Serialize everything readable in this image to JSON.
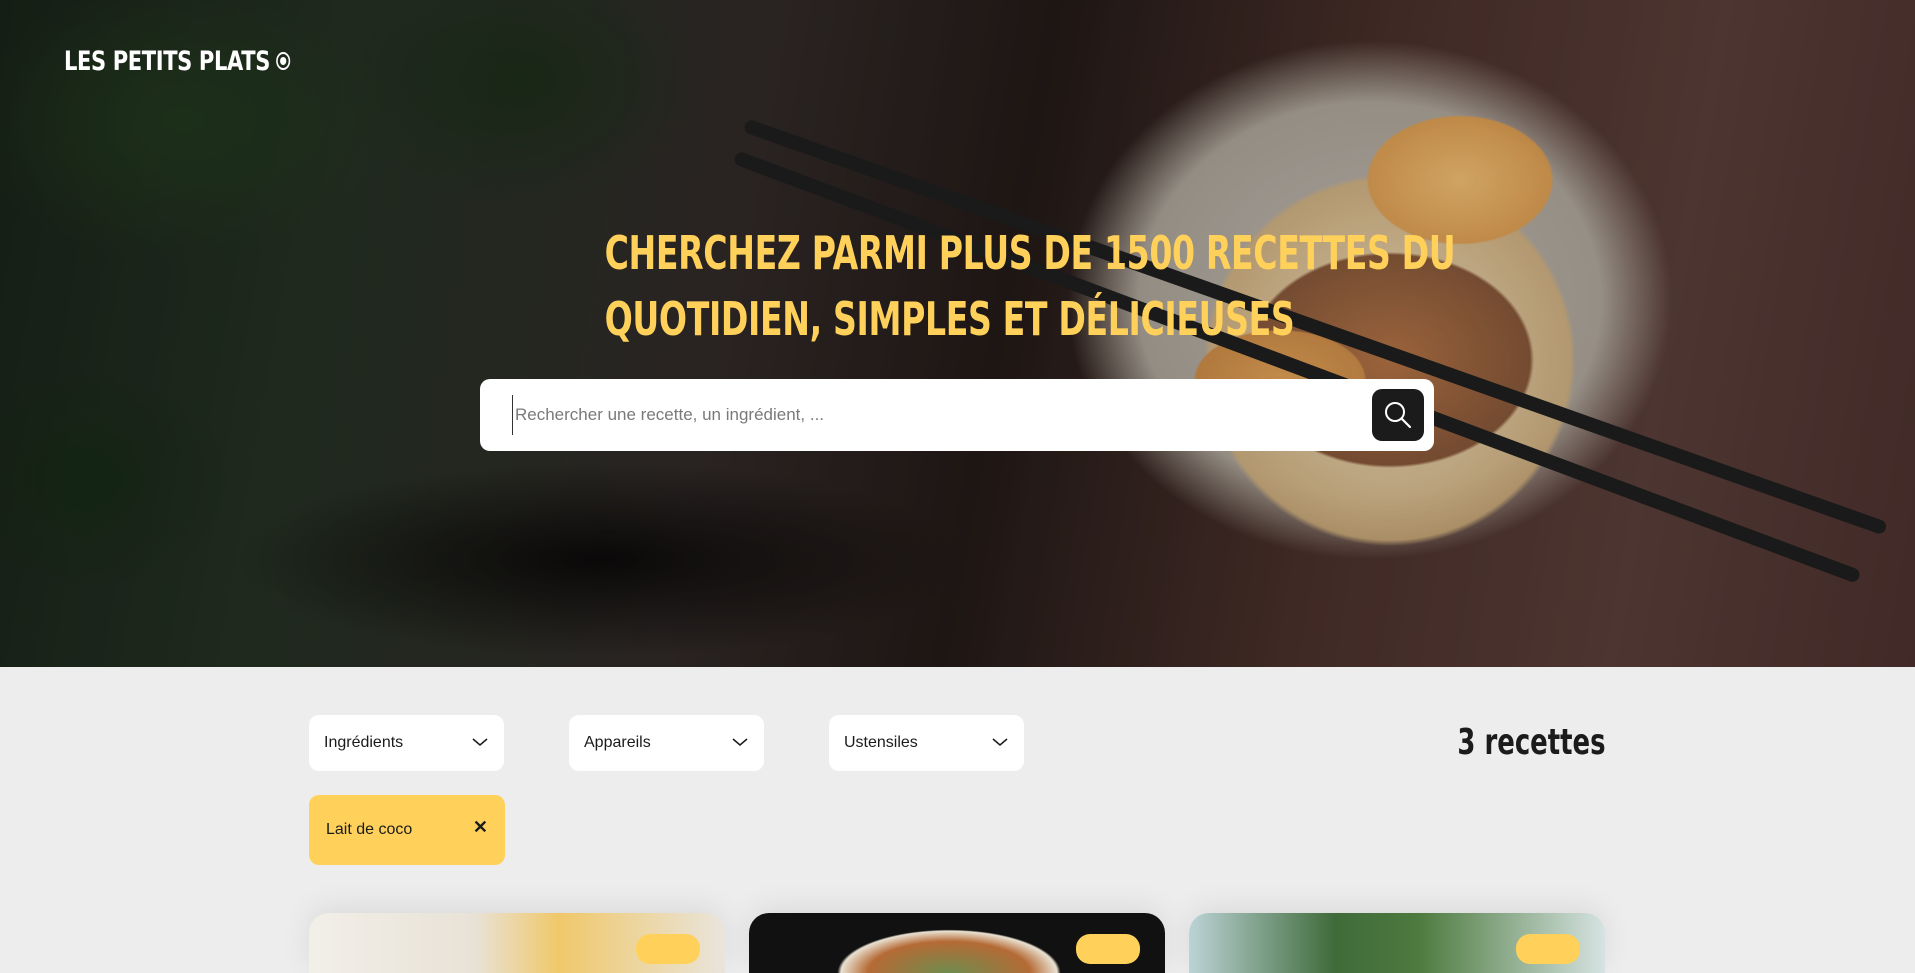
{
  "brand": {
    "logo_text": "LES PETITS PLATS"
  },
  "hero": {
    "title_line1": "CHERCHEZ PARMI PLUS DE 1500 RECETTES DU",
    "title_line2": "QUOTIDIEN, SIMPLES ET DÉLICIEUSES"
  },
  "search": {
    "value": "",
    "placeholder": "Rechercher une recette, un ingrédient, ...",
    "button_icon": "search-icon"
  },
  "filters": {
    "dropdowns": [
      {
        "label": "Ingrédients",
        "icon": "chevron-down-icon"
      },
      {
        "label": "Appareils",
        "icon": "chevron-down-icon"
      },
      {
        "label": "Ustensiles",
        "icon": "chevron-down-icon"
      }
    ],
    "active_tags": [
      {
        "label": "Lait de coco",
        "close_icon": "close-icon",
        "close_glyph": "✕"
      }
    ]
  },
  "results": {
    "count_label": "3 recettes"
  },
  "colors": {
    "accent": "#ffd15b",
    "dark": "#1b1b1b",
    "background": "#ededed"
  }
}
